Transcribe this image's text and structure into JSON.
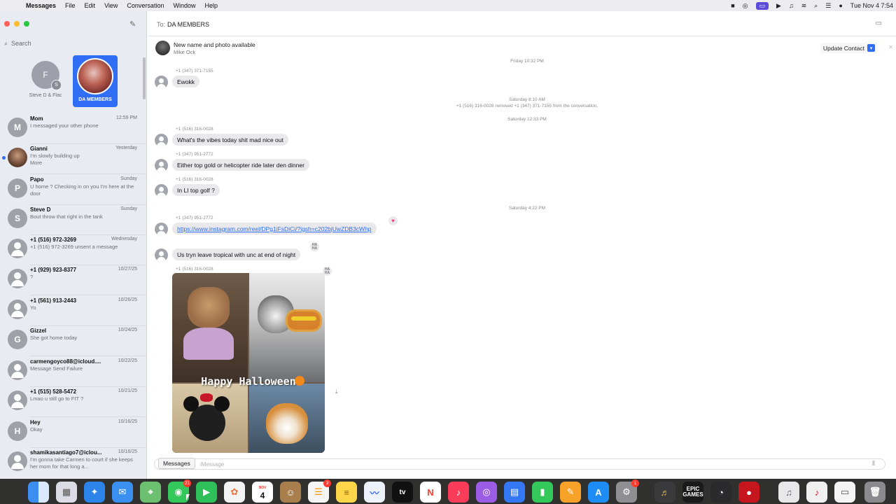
{
  "menubar": {
    "items": [
      "Messages",
      "File",
      "Edit",
      "View",
      "Conversation",
      "Window",
      "Help"
    ],
    "clock": "Tue Nov 4  7:54"
  },
  "sidebar": {
    "search_placeholder": "Search",
    "pinned": [
      {
        "initial": "F",
        "sub_initial": "S",
        "label": "Steve D & Flac"
      },
      {
        "label": "DA MEMBERS"
      }
    ],
    "conversations": [
      {
        "initial": "M",
        "name": "Mom",
        "time": "12:59 PM",
        "preview": "I messaged your other phone"
      },
      {
        "initial": "",
        "name": "Gianni",
        "time": "Yesterday",
        "preview": "I'm slowly building up\nMore",
        "unread": true
      },
      {
        "initial": "P",
        "name": "Papo",
        "time": "Sunday",
        "preview": "U home ? Checking in on you I'm here at the door"
      },
      {
        "initial": "S",
        "name": "Steve D",
        "time": "Sunday",
        "preview": "Bout throw that right in the tank"
      },
      {
        "initial": "",
        "name": "+1 (516) 972-3269",
        "time": "Wednesday",
        "preview": "+1 (516) 972-3269 unsent a message"
      },
      {
        "initial": "",
        "name": "+1 (929) 923-8377",
        "time": "10/27/25",
        "preview": "?"
      },
      {
        "initial": "",
        "name": "+1 (561) 913-2443",
        "time": "10/26/25",
        "preview": "Yo"
      },
      {
        "initial": "G",
        "name": "Gizzel",
        "time": "10/24/25",
        "preview": "She got home today"
      },
      {
        "initial": "",
        "name": "carmengoyco88@icloud....",
        "time": "10/22/25",
        "preview": "Message Send Failure"
      },
      {
        "initial": "",
        "name": "+1 (515) 528-5472",
        "time": "10/21/25",
        "preview": "Lmao u still go to FIT ?"
      },
      {
        "initial": "H",
        "name": "Hey",
        "time": "10/16/25",
        "preview": "Okay"
      },
      {
        "initial": "",
        "name": "shamikasantiago7@iclou...",
        "time": "10/16/25",
        "preview": "I'm gonna take Carmen to court if she keeps her mom for that long a..."
      }
    ]
  },
  "header": {
    "to_label": "To:",
    "recipient": "DA MEMBERS"
  },
  "banner": {
    "title": "New name and photo available",
    "subtitle": "Mike Ock",
    "button": "Update Contact"
  },
  "thread": {
    "ts_friday": "Friday 10:32 PM",
    "sender_1": "+1 (347) 371-7155",
    "msg_1": "Ewokk",
    "ts_sat_810": "Saturday 8:10 AM",
    "system_1": "+1 (516) 316-0028 removed +1 (347) 371-7155 from the conversation.",
    "ts_sat_1233": "Saturday 12:33 PM",
    "sender_2": "+1 (516) 316-0028",
    "msg_2": "What's the vibes today shit mad nice out",
    "sender_3": "+1 (347) 951-2772",
    "msg_3": "Either top gold or helicopter ride later den dinner",
    "sender_4": "+1 (516) 316-0028",
    "msg_4": "In LI top golf ?",
    "ts_sat_422": "Saturday 4:22 PM",
    "sender_5": "+1 (347) 951-2772",
    "msg_5": "https://www.instagram.com/reel/DPg1iFsDiCi/?igsh=c202bjUwZDB3cWhp",
    "msg_6": "Us tryn leave tropical with unc at end of night",
    "sender_7": "+1 (516) 316-0028",
    "photo_caption": "Happy Halloween",
    "tapback_haha": "HA HA",
    "tapback_heart": "♥"
  },
  "composer": {
    "placeholder": "iMessage",
    "tooltip": "Messages"
  },
  "dock": {
    "messages_badge": "21",
    "calendar_month": "NOV",
    "calendar_day": "4",
    "reminders_badge": "3",
    "settings_badge": "1",
    "epic_label": "EPIC GAMES",
    "appletv_label": "tv"
  }
}
